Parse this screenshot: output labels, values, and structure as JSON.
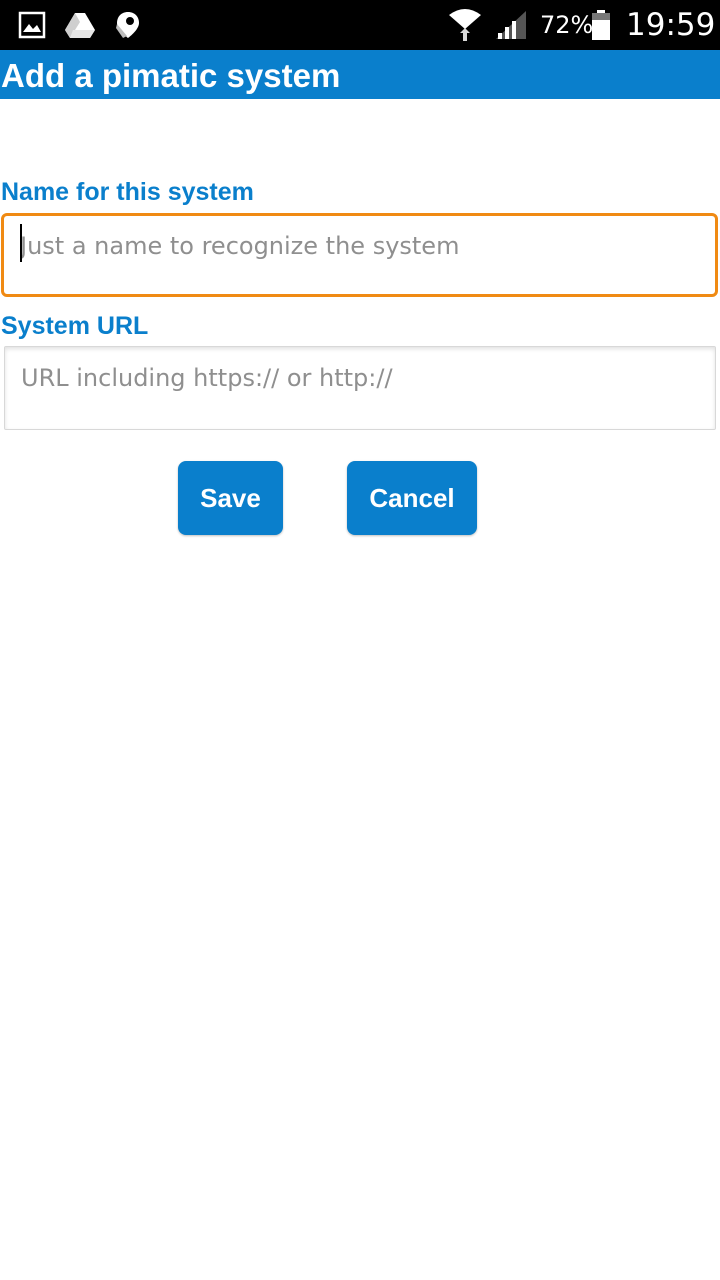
{
  "status_bar": {
    "battery_percent": "72%",
    "time": "19:59",
    "icons": [
      "gallery-icon",
      "drive-icon",
      "maps-icon",
      "wifi-icon",
      "signal-icon",
      "battery-icon"
    ]
  },
  "header": {
    "title": "Add a pimatic system",
    "background_color": "#0a7fcc"
  },
  "form": {
    "name_label": "Name for this system",
    "name_value": "",
    "name_placeholder": "Just a name to recognize the system",
    "url_label": "System URL",
    "url_value": "",
    "url_placeholder": "URL including https:// or http://",
    "focus_color": "#f08a13"
  },
  "buttons": {
    "save_label": "Save",
    "cancel_label": "Cancel"
  }
}
